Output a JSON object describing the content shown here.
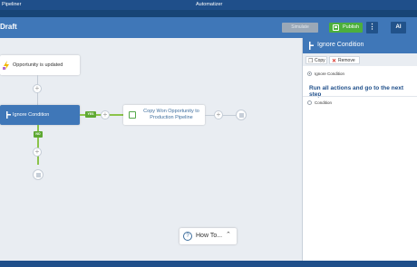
{
  "titlebar": {
    "app_name": "Pipeliner",
    "center_title": "Automatizer"
  },
  "header": {
    "title": "Draft",
    "simulate_label": "Simulate",
    "publish_label": "Publish",
    "more_label": "⋮",
    "ai_label": "AI"
  },
  "canvas": {
    "trigger_label": "Opportunity is updated",
    "condition_label": "Ignore Condition",
    "action_label_line1": "Copy Won Opportunity to",
    "action_label_line2": "Production Pipeline",
    "yes_tag": "YES",
    "no_tag": "NO",
    "plus_symbol": "+"
  },
  "howto": {
    "label": "How To...",
    "icon": "?",
    "chevron": "⌃"
  },
  "panel": {
    "title": "Ignore Condition",
    "copy_label": "Copy",
    "remove_label": "Remove",
    "option_ignore": "Ignore Condition",
    "option_condition": "Condition",
    "description": "Run all actions and go to the next step"
  },
  "colors": {
    "brand": "#1f4f8a",
    "header": "#3f77b8",
    "publish": "#4caf3c",
    "yes": "#8bc34a"
  }
}
